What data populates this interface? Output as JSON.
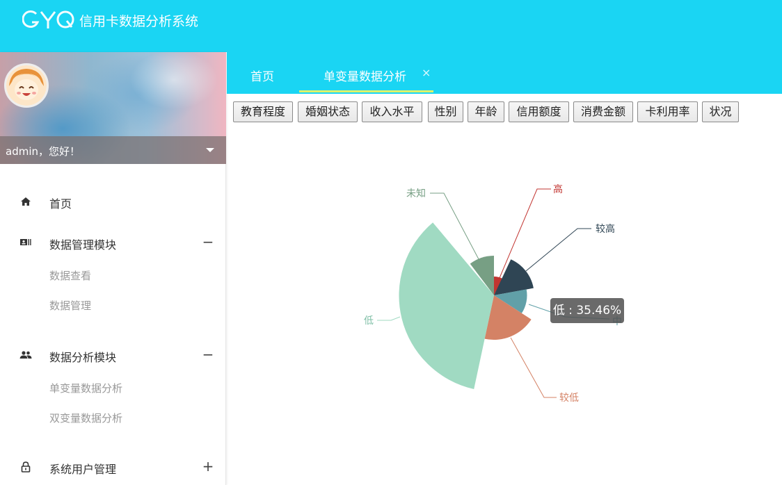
{
  "header": {
    "logo_text": "GYQ",
    "title": "信用卡数据分析系统",
    "brand_color": "#1ad5f3"
  },
  "sidebar": {
    "user": {
      "greeting": "admin，您好！"
    },
    "items": [
      {
        "label": "首页",
        "icon": "home-icon"
      },
      {
        "label": "数据管理模块",
        "icon": "id-card-icon",
        "toggle": "−",
        "children": [
          "数据查看",
          "数据管理"
        ]
      },
      {
        "label": "数据分析模块",
        "icon": "users-icon",
        "toggle": "−",
        "children": [
          "单变量数据分析",
          "双变量数据分析"
        ]
      },
      {
        "label": "系统用户管理",
        "icon": "lock-icon",
        "toggle": "+"
      }
    ]
  },
  "tabs": [
    {
      "label": "首页",
      "active": false
    },
    {
      "label": "单变量数据分析",
      "active": true,
      "close": "×"
    }
  ],
  "buttons": [
    "教育程度",
    "婚姻状态",
    "收入水平",
    "性别",
    "年龄",
    "信用额度",
    "消费金额",
    "卡利用率",
    "状况"
  ],
  "tooltip": {
    "text": "低 : 35.46%"
  },
  "chart_data": {
    "type": "pie",
    "variant": "nightingale-rose",
    "series": [
      {
        "name": "未知",
        "color": "#779f84"
      },
      {
        "name": "高",
        "color": "#c23531"
      },
      {
        "name": "较高",
        "color": "#2f4554"
      },
      {
        "name": "中",
        "color": "#61a0a8"
      },
      {
        "name": "较低",
        "color": "#d48265"
      },
      {
        "name": "低",
        "color": "#a0dac2",
        "percent": 35.46
      }
    ]
  }
}
